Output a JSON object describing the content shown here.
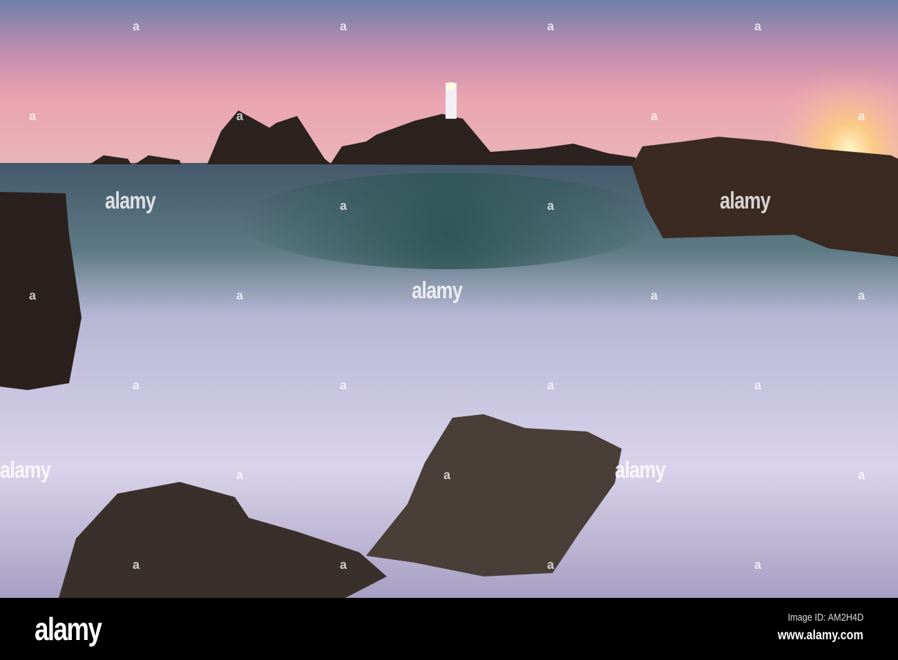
{
  "photo": {
    "subject": "lighthouse-seascape-sunset"
  },
  "watermark": {
    "text": "alamy",
    "mark": "a"
  },
  "footer": {
    "logo": "alamy",
    "image_id": "Image ID: AM2H4D",
    "website": "www.alamy.com"
  },
  "colors": {
    "sky_top": "#6a7fa8",
    "sky_pink": "#e7a0b4",
    "sea": "#3f5564",
    "foam": "#d8d2ea",
    "rock": "#2a211d"
  }
}
